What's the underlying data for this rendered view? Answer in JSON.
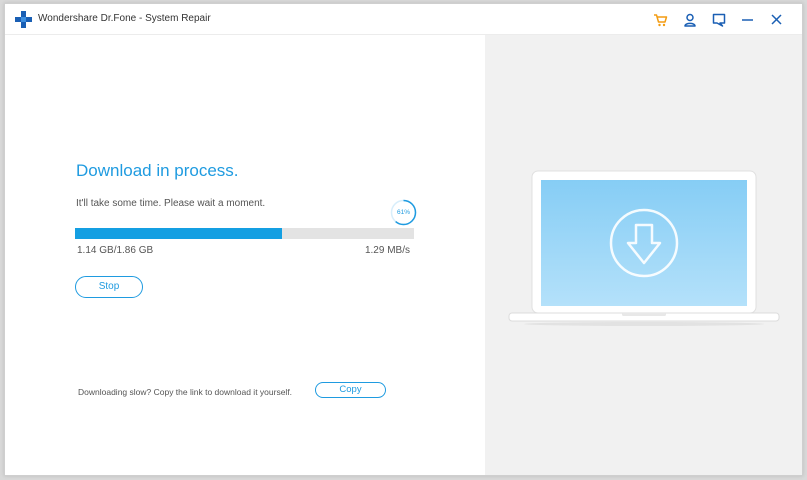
{
  "titlebar": {
    "title": "Wondershare Dr.Fone - System Repair",
    "icons": [
      "cart-icon",
      "user-icon",
      "feedback-icon",
      "minimize-icon",
      "close-icon"
    ]
  },
  "download": {
    "heading": "Download in process.",
    "subtext": "It'll take some time. Please wait a moment.",
    "percent": "61%",
    "progress_fraction": 0.61,
    "size": "1.14 GB/1.86 GB",
    "speed": "1.29 MB/s",
    "stop_label": "Stop"
  },
  "footer": {
    "slow_text": "Downloading slow? Copy the link to download it yourself.",
    "copy_label": "Copy"
  },
  "colors": {
    "accent": "#1f9be0",
    "progress": "#149fe2",
    "track": "#e3e3e3",
    "right_pane": "#f1f1f1",
    "screen": "#8fd2f6",
    "cart": "#f39c12"
  },
  "illustration": {
    "icon": "download-arrow-icon"
  }
}
